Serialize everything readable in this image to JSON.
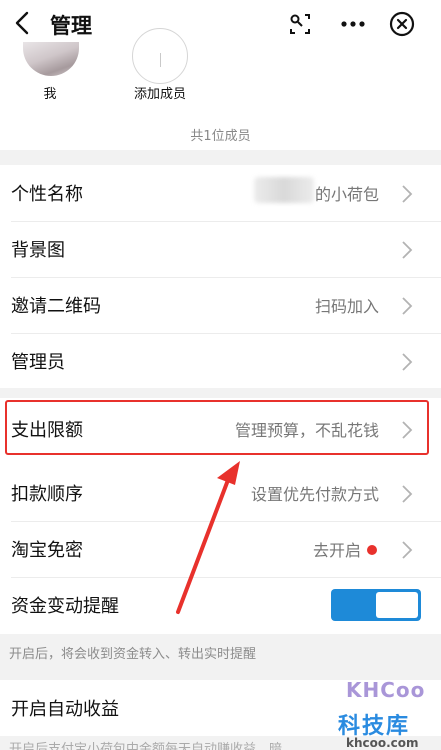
{
  "header": {
    "title": "管理"
  },
  "members": {
    "me_label": "我",
    "add_label": "添加成员",
    "count_text": "共1位成员"
  },
  "settings": {
    "nickname": {
      "label": "个性名称",
      "value": "的小荷包"
    },
    "background": {
      "label": "背景图"
    },
    "invite_qr": {
      "label": "邀请二维码",
      "value": "扫码加入"
    },
    "admin": {
      "label": "管理员"
    },
    "spend_limit": {
      "label": "支出限额",
      "value": "管理预算，不乱花钱"
    },
    "deduct_order": {
      "label": "扣款顺序",
      "value": "设置优先付款方式"
    },
    "taobao": {
      "label": "淘宝免密",
      "value": "去开启"
    },
    "fund_alert": {
      "label": "资金变动提醒",
      "enabled": true
    },
    "fund_alert_hint": "开启后，将会收到资金转入、转出实时提醒",
    "auto_yield": {
      "label": "开启自动收益"
    },
    "auto_yield_hint": "开启后支付宝小荷包中金额每天自动赚收益，暗"
  },
  "watermark": {
    "logo": "KHCoo",
    "name": "科技库",
    "url": "khcoo.com"
  },
  "colors": {
    "accent_blue": "#1e8ad8",
    "highlight_red": "#e8312c"
  },
  "icons": [
    "back-arrow-icon",
    "scan-icon",
    "more-icon",
    "close-circle-icon",
    "chevron-right-icon"
  ]
}
